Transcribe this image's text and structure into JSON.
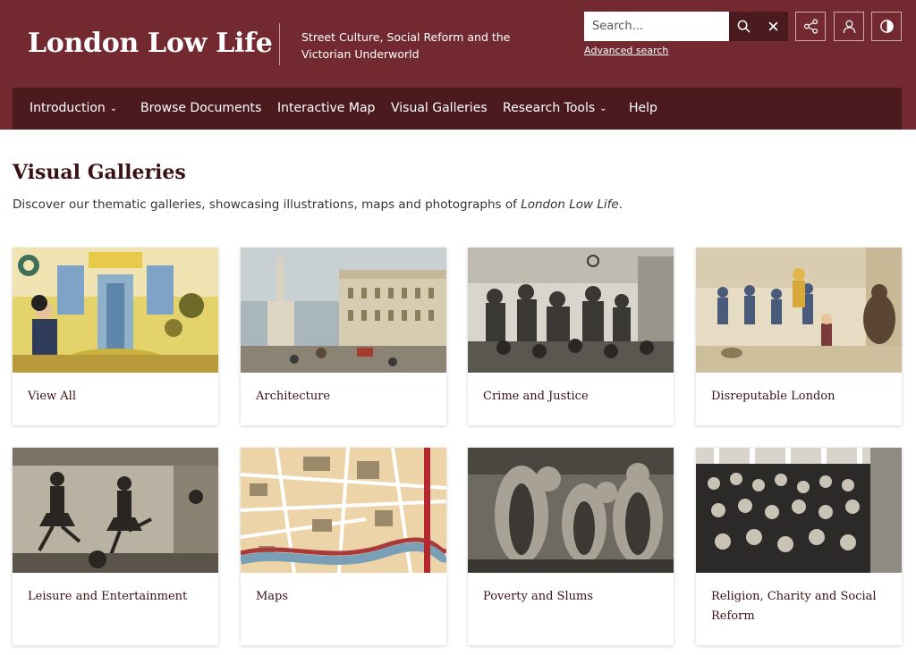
{
  "header": {
    "logo": "London Low Life",
    "tagline": "Street Culture, Social Reform and the Victorian Underworld",
    "search_placeholder": "Search...",
    "advanced_search": "Advanced search",
    "icons": [
      "search-icon",
      "close-icon",
      "share-icon",
      "user-icon",
      "contrast-icon"
    ]
  },
  "nav": {
    "items": [
      {
        "label": "Introduction",
        "dropdown": true
      },
      {
        "label": "Browse Documents",
        "dropdown": false
      },
      {
        "label": "Interactive Map",
        "dropdown": false
      },
      {
        "label": "Visual Galleries",
        "dropdown": false
      },
      {
        "label": "Research Tools",
        "dropdown": true
      },
      {
        "label": "Help",
        "dropdown": false
      }
    ]
  },
  "main": {
    "title": "Visual Galleries",
    "intro_prefix": "Discover our thematic galleries, showcasing illustrations, maps and photographs of ",
    "intro_italic": "London Low Life",
    "intro_suffix": ".",
    "galleries": [
      {
        "label": "View All"
      },
      {
        "label": "Architecture"
      },
      {
        "label": "Crime and Justice"
      },
      {
        "label": "Disreputable London"
      },
      {
        "label": "Leisure and Entertainment"
      },
      {
        "label": "Maps"
      },
      {
        "label": "Poverty and Slums"
      },
      {
        "label": "Religion, Charity and Social Reform"
      }
    ]
  },
  "colors": {
    "header_bg": "#722a30",
    "nav_bg": "#4a1a1f",
    "heading_text": "#3a1114"
  }
}
